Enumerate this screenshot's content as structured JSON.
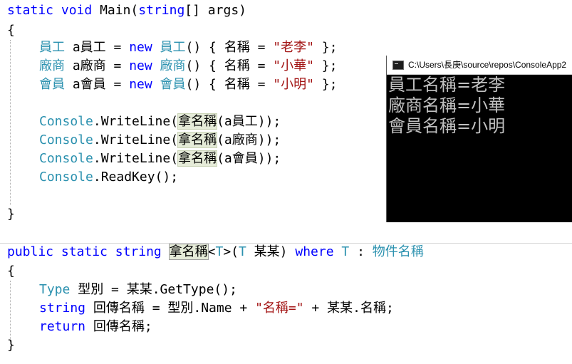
{
  "code": {
    "main_sig": {
      "kw1": "static",
      "kw2": "void",
      "name": " Main(",
      "kw3": "string",
      "rest": "[] args)"
    },
    "open1": "{",
    "decl1": {
      "type": "員工",
      "var": " a員工 = ",
      "kw": "new",
      "ctor": "員工",
      "mid": "() { 名稱 = ",
      "str": "\"老李\"",
      "end": " };"
    },
    "decl2": {
      "type": "廠商",
      "var": " a廠商 = ",
      "kw": "new",
      "ctor": "廠商",
      "mid": "() { 名稱 = ",
      "str": "\"小華\"",
      "end": " };"
    },
    "decl3": {
      "type": "會員",
      "var": " a會員 = ",
      "kw": "new",
      "ctor": "會員",
      "mid": "() { 名稱 = ",
      "str": "\"小明\"",
      "end": " };"
    },
    "wl1": {
      "cls": "Console",
      "call": ".WriteLine(",
      "fn": "拿名稱",
      "args": "(a員工));"
    },
    "wl2": {
      "cls": "Console",
      "call": ".WriteLine(",
      "fn": "拿名稱",
      "args": "(a廠商));"
    },
    "wl3": {
      "cls": "Console",
      "call": ".WriteLine(",
      "fn": "拿名稱",
      "args": "(a會員));"
    },
    "readkey": {
      "cls": "Console",
      "call": ".ReadKey();"
    },
    "close1": "}",
    "method_sig": {
      "kw1": "public",
      "kw2": "static",
      "kw3": "string",
      "fn": "拿名稱",
      "lt": "<",
      "tp": "T",
      "gt": ">(",
      "ptype": "T",
      "pname": " 某某) ",
      "where": "where",
      "t2": "T",
      "colon": " : ",
      "iface": "物件名稱"
    },
    "open2": "{",
    "stmt1": {
      "type": "Type",
      "rest": " 型別 = 某某.GetType();"
    },
    "stmt2": {
      "kw": "string",
      "mid": " 回傳名稱 = 型別.Name + ",
      "str": "\"名稱=\"",
      "end": " + 某某.名稱;"
    },
    "stmt3": {
      "kw": "return",
      "rest": " 回傳名稱;"
    },
    "close2": "}"
  },
  "console": {
    "title": "C:\\Users\\長庚\\source\\repos\\ConsoleApp2",
    "output": [
      "員工名稱=老李",
      "廠商名稱=小華",
      "會員名稱=小明"
    ]
  }
}
